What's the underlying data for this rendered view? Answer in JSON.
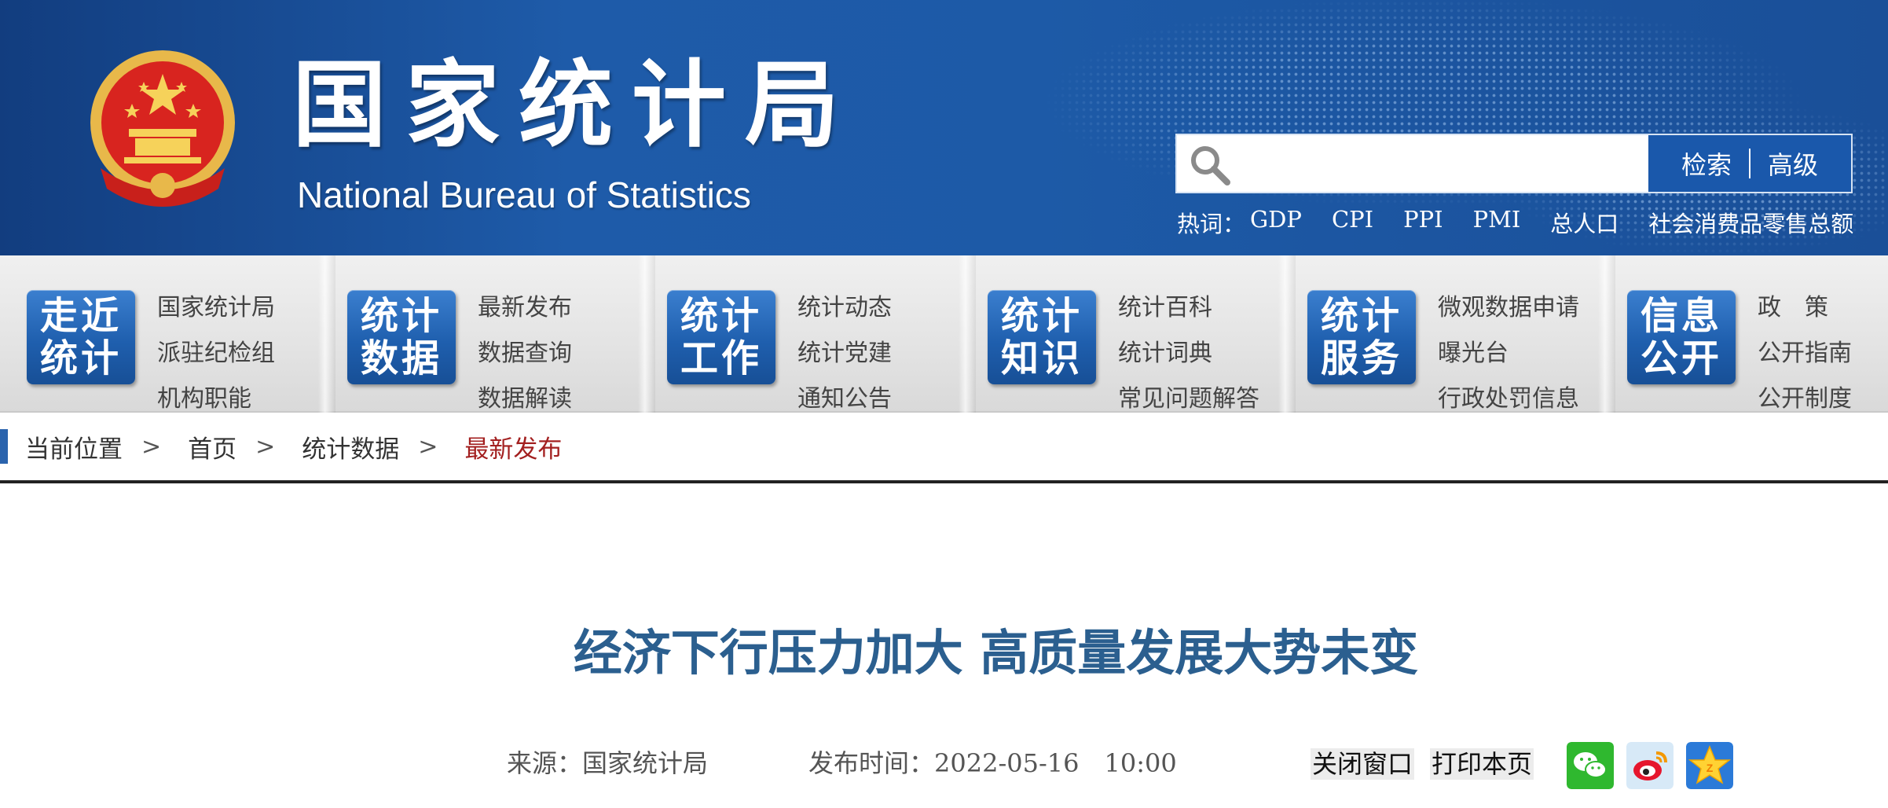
{
  "header": {
    "title_cn": "国家统计局",
    "title_en": "National Bureau of Statistics",
    "search": {
      "placeholder": "",
      "search_label": "检索",
      "advanced_label": "高级"
    },
    "hot_label": "热词：",
    "hot_words": [
      "GDP",
      "CPI",
      "PPI",
      "PMI",
      "总人口",
      "社会消费品零售总额"
    ]
  },
  "nav": [
    {
      "tile_line1": "走近",
      "tile_line2": "统计",
      "links": [
        "国家统计局",
        "派驻纪检组",
        "机构职能"
      ]
    },
    {
      "tile_line1": "统计",
      "tile_line2": "数据",
      "links": [
        "最新发布",
        "数据查询",
        "数据解读"
      ]
    },
    {
      "tile_line1": "统计",
      "tile_line2": "工作",
      "links": [
        "统计动态",
        "统计党建",
        "通知公告"
      ]
    },
    {
      "tile_line1": "统计",
      "tile_line2": "知识",
      "links": [
        "统计百科",
        "统计词典",
        "常见问题解答"
      ]
    },
    {
      "tile_line1": "统计",
      "tile_line2": "服务",
      "links": [
        "微观数据申请",
        "曝光台",
        "行政处罚信息"
      ]
    },
    {
      "tile_line1": "信息",
      "tile_line2": "公开",
      "links": [
        "政　策",
        "公开指南",
        "公开制度"
      ]
    }
  ],
  "breadcrumb": {
    "label": "当前位置",
    "items": [
      "首页",
      "统计数据"
    ],
    "current": "最新发布",
    "separator": ">"
  },
  "article": {
    "title": "经济下行压力加大 高质量发展大势未变",
    "source": "来源：国家统计局",
    "publish_time": "发布时间：2022-05-16　10:00"
  },
  "tools": {
    "close_window": "关闭窗口",
    "print_page": "打印本页"
  },
  "share_icons": [
    "wechat-icon",
    "weibo-icon",
    "qzone-icon"
  ],
  "colors": {
    "header_blue": "#1d5aa7",
    "tile_blue": "#1f5fae",
    "title_blue": "#2b5f8f",
    "current_crumb": "#a32020"
  }
}
